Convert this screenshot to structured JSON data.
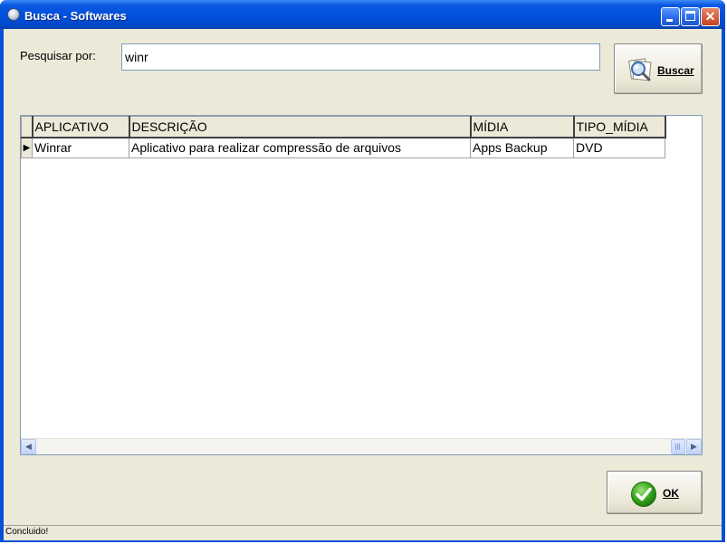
{
  "window": {
    "title": "Busca - Softwares"
  },
  "search": {
    "label": "Pesquisar por:",
    "value": "winr",
    "button_label": "Buscar"
  },
  "grid": {
    "columns": [
      "APLICATIVO",
      "DESCRIÇÃO",
      "MÍDIA",
      "TIPO_MÍDIA"
    ],
    "rows": [
      {
        "aplicativo": "Winrar",
        "descricao": "Aplicativo para realizar compressão de arquivos",
        "midia": "Apps Backup",
        "tipo_midia": "DVD"
      }
    ]
  },
  "actions": {
    "ok_label": "OK"
  },
  "status": {
    "text": "Concluido!"
  },
  "icons": {
    "app": "app-icon",
    "search": "magnifier-icon",
    "ok": "green-check-icon",
    "row_indicator": "triangle-right-icon"
  },
  "colors": {
    "titlebar": "#0250dc",
    "window_bg": "#ece9d8",
    "ok_green": "#3aa81f"
  }
}
